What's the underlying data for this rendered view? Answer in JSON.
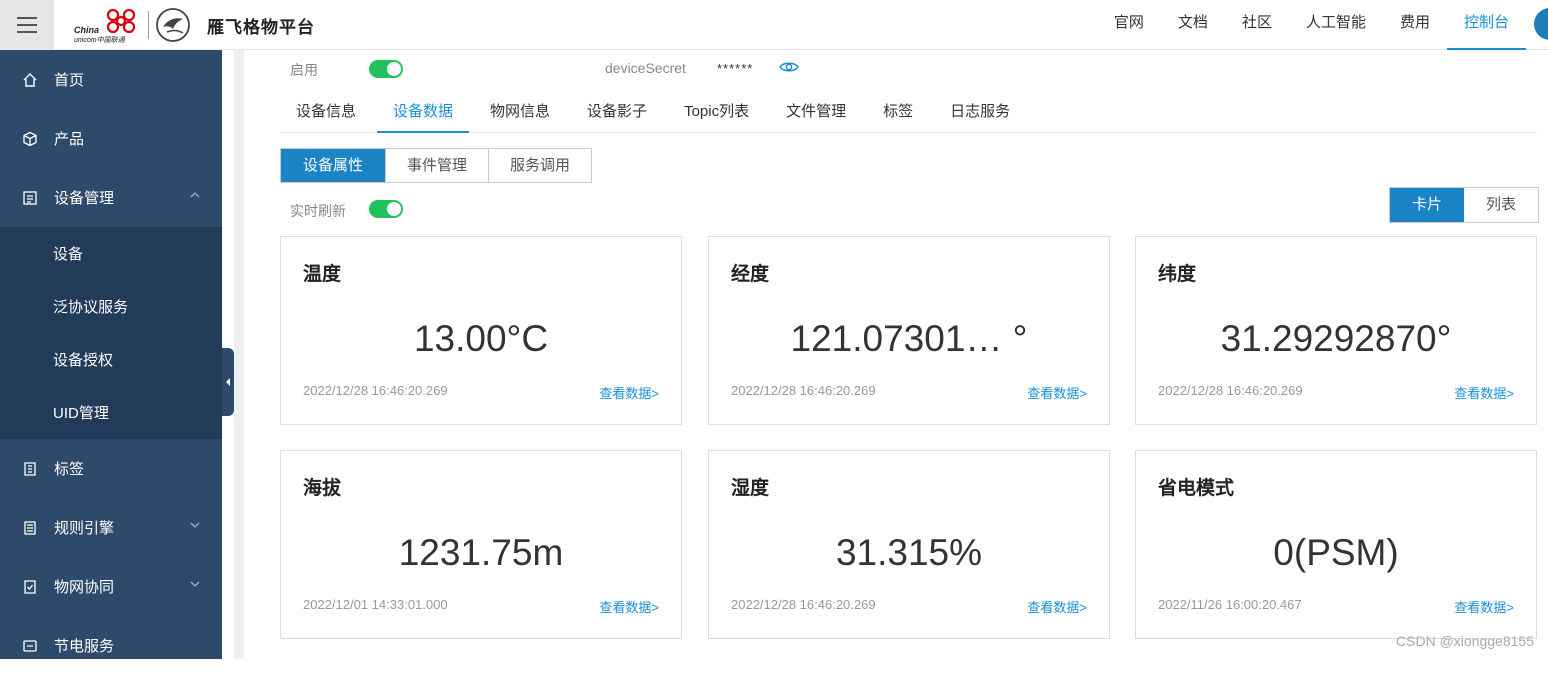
{
  "header": {
    "brand": "雁飞格物平台",
    "logo_text_1": "China",
    "logo_text_2": "unicom中国联通",
    "nav": [
      "官网",
      "文档",
      "社区",
      "人工智能",
      "费用",
      "控制台"
    ],
    "active_nav": "控制台"
  },
  "sidebar": {
    "items": [
      {
        "label": "首页",
        "icon": "home-icon"
      },
      {
        "label": "产品",
        "icon": "cube-icon"
      },
      {
        "label": "设备管理",
        "icon": "list-icon"
      },
      {
        "label": "标签",
        "icon": "tag-icon"
      },
      {
        "label": "规则引擎",
        "icon": "doc-icon"
      },
      {
        "label": "物网协同",
        "icon": "check-doc-icon"
      },
      {
        "label": "节电服务",
        "icon": "saver-icon"
      }
    ],
    "subitems": [
      "设备",
      "泛协议服务",
      "设备授权",
      "UID管理"
    ]
  },
  "device": {
    "status_label": "启用",
    "secret_label": "deviceSecret",
    "secret_value": "******"
  },
  "tabs": [
    "设备信息",
    "设备数据",
    "物网信息",
    "设备影子",
    "Topic列表",
    "文件管理",
    "标签",
    "日志服务"
  ],
  "active_tab": "设备数据",
  "subtabs": [
    "设备属性",
    "事件管理",
    "服务调用"
  ],
  "active_subtab": "设备属性",
  "refresh_label": "实时刷新",
  "view_switch": [
    "卡片",
    "列表"
  ],
  "cards": [
    {
      "title": "温度",
      "value": "13.00°C",
      "time": "2022/12/28 16:46:20.269",
      "link": "查看数据>"
    },
    {
      "title": "经度",
      "value": "121.07301… °",
      "time": "2022/12/28 16:46:20.269",
      "link": "查看数据>"
    },
    {
      "title": "纬度",
      "value": "31.29292870°",
      "time": "2022/12/28 16:46:20.269",
      "link": "查看数据>"
    },
    {
      "title": "海拔",
      "value": "1231.75m",
      "time": "2022/12/01 14:33:01.000",
      "link": "查看数据>"
    },
    {
      "title": "湿度",
      "value": "31.315%",
      "time": "2022/12/28 16:46:20.269",
      "link": "查看数据>"
    },
    {
      "title": "省电模式",
      "value": "0(PSM)",
      "time": "2022/11/26 16:00:20.467",
      "link": "查看数据>"
    }
  ],
  "watermark": "CSDN @xiongge8155",
  "colors": {
    "accent": "#1890d8",
    "sidebar": "#2e4a6b",
    "toggle": "#21c25e"
  }
}
